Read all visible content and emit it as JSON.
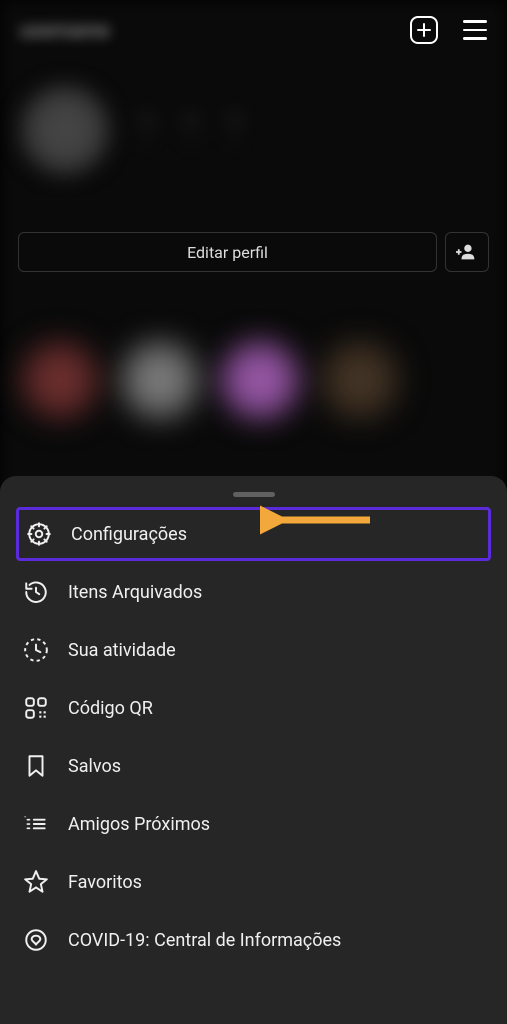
{
  "header": {
    "username_blurred": "username"
  },
  "profile": {
    "edit_button": "Editar perfil"
  },
  "menu": {
    "items": [
      {
        "label": "Configurações",
        "icon": "gear-icon",
        "highlighted": true
      },
      {
        "label": "Itens Arquivados",
        "icon": "history-icon",
        "highlighted": false
      },
      {
        "label": "Sua atividade",
        "icon": "activity-icon",
        "highlighted": false
      },
      {
        "label": "Código QR",
        "icon": "qr-icon",
        "highlighted": false
      },
      {
        "label": "Salvos",
        "icon": "bookmark-icon",
        "highlighted": false
      },
      {
        "label": "Amigos Próximos",
        "icon": "close-friends-icon",
        "highlighted": false
      },
      {
        "label": "Favoritos",
        "icon": "star-icon",
        "highlighted": false
      },
      {
        "label": "COVID-19: Central de Informações",
        "icon": "covid-icon",
        "highlighted": false
      }
    ]
  }
}
